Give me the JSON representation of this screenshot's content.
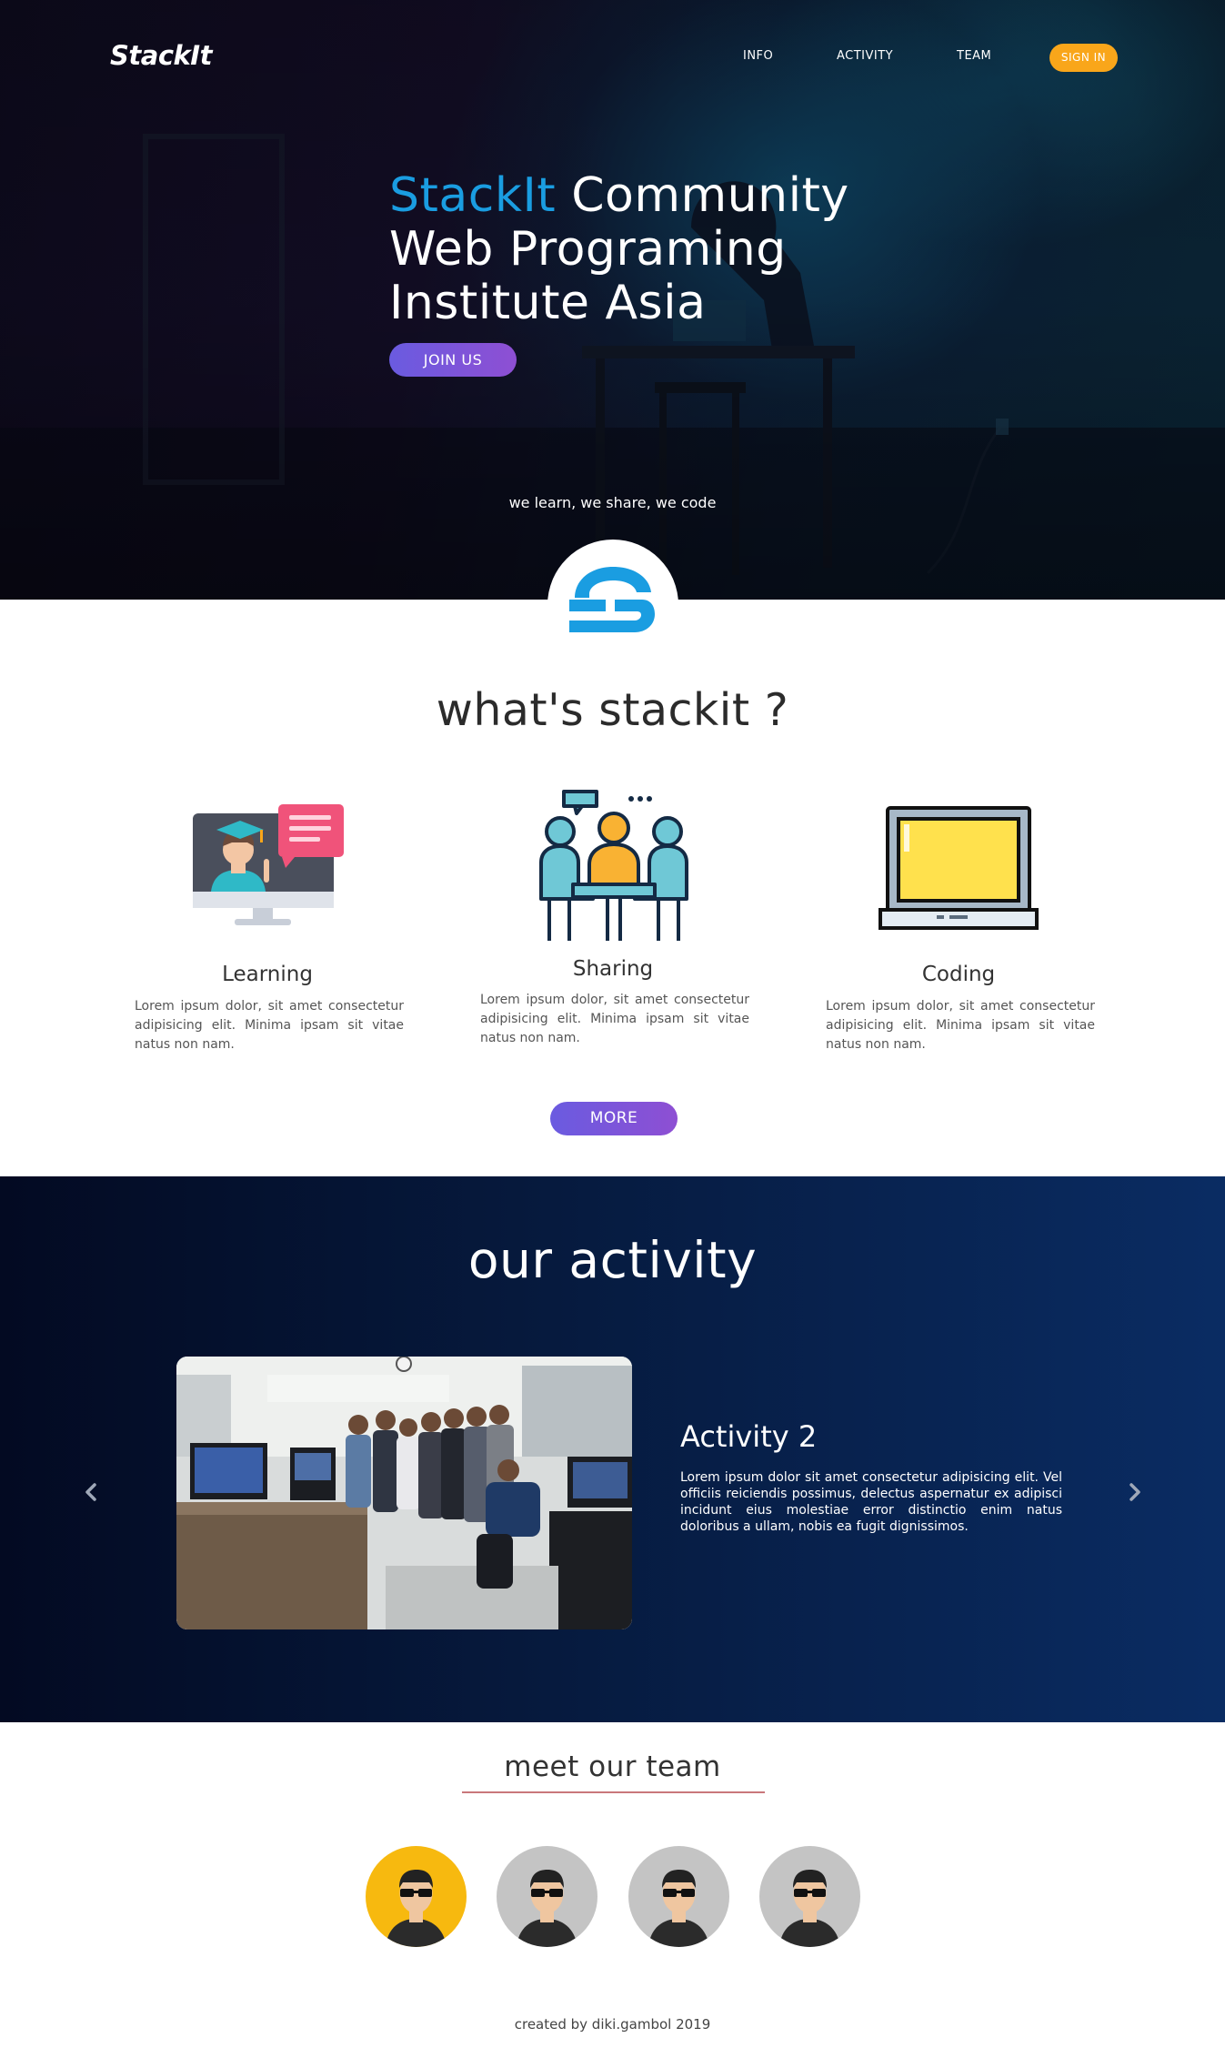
{
  "header": {
    "logo": "StackIt",
    "nav": [
      "INFO",
      "ACTIVITY",
      "TEAM"
    ],
    "signin_label": "SIGN IN"
  },
  "hero": {
    "brand": "StackIt",
    "title_line1_rest": " Community",
    "title_line2": "Web Programing",
    "title_line3": "Institute Asia",
    "join_label": "JOIN US",
    "tagline": "we learn, we share, we code"
  },
  "about": {
    "title": "what's stackit ?",
    "features": [
      {
        "name": "Learning",
        "text": "Lorem ipsum dolor, sit amet consectetur adipisicing elit. Minima ipsam sit vitae natus non nam.",
        "icon": "teacher-monitor-icon"
      },
      {
        "name": "Sharing",
        "text": "Lorem ipsum dolor, sit amet consectetur adipisicing elit. Minima ipsam sit vitae natus non nam.",
        "icon": "meeting-people-icon"
      },
      {
        "name": "Coding",
        "text": "Lorem ipsum dolor, sit amet consectetur adipisicing elit. Minima ipsam sit vitae natus non nam.",
        "icon": "laptop-icon"
      }
    ],
    "more_label": "MORE"
  },
  "activity": {
    "title": "our activity",
    "slide_heading": "Activity 2",
    "slide_text": "Lorem ipsum dolor sit amet consectetur adipisicing elit. Vel officiis reiciendis possimus, delectus aspernatur ex adipisci incidunt eius molestiae error distinctio enim natus doloribus a ullam, nobis ea fugit dignissimos."
  },
  "team": {
    "title": "meet our team",
    "members": [
      {
        "icon": "avatar-icon",
        "bg": "#f7b90f"
      },
      {
        "icon": "avatar-icon",
        "bg": "#c4c4c4"
      },
      {
        "icon": "avatar-icon",
        "bg": "#c4c4c4"
      },
      {
        "icon": "avatar-icon",
        "bg": "#c4c4c4"
      }
    ]
  },
  "footer": {
    "credit": "created by diki.gambol 2019"
  },
  "colors": {
    "brand_blue": "#1a9de1",
    "accent_orange": "#f9a61a",
    "button_purple": "#7b55dc",
    "active_avatar": "#f7b90f"
  }
}
